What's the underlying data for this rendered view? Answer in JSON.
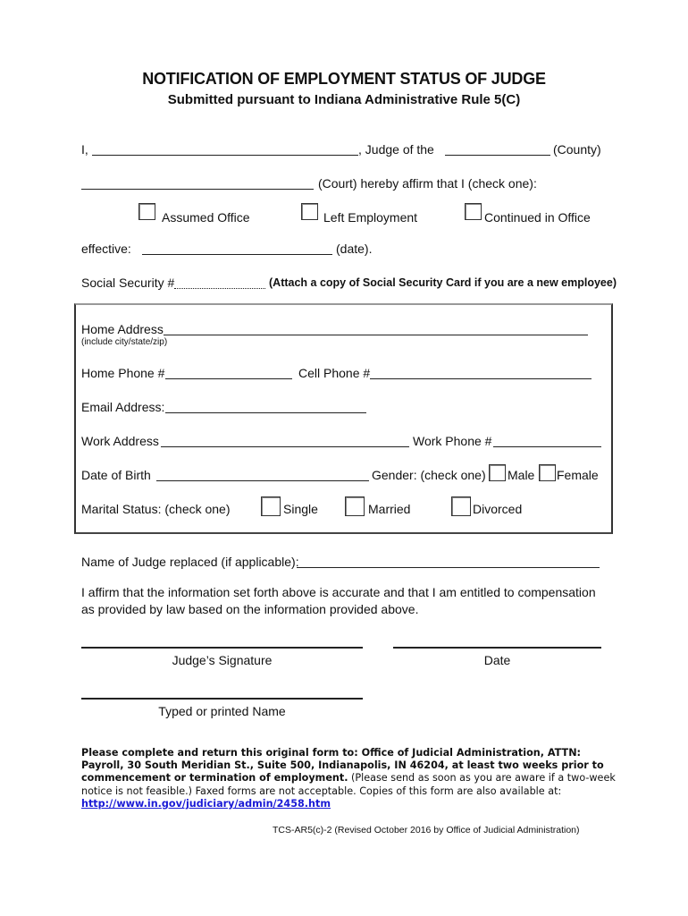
{
  "header": {
    "title": "NOTIFICATION OF EMPLOYMENT STATUS OF JUDGE",
    "subtitle": "Submitted pursuant to Indiana Administrative Rule 5(C)"
  },
  "intro": {
    "prefix": "I,",
    "judge_of_the": ", Judge of the",
    "county_label": "(County)",
    "court_label": "(Court) hereby affirm that I (check one):",
    "name_value": "",
    "county_value": "",
    "court_value": ""
  },
  "status_options": [
    {
      "label": "Assumed Office",
      "checked": false
    },
    {
      "label": "Left Employment",
      "checked": false
    },
    {
      "label": "Continued in Office",
      "checked": false
    }
  ],
  "effective": {
    "label": "effective:",
    "suffix": "(date).",
    "value": ""
  },
  "ssn": {
    "label": "Social Security #",
    "value": "",
    "note": "(Attach a copy of Social Security Card if you are a new employee)"
  },
  "personal": {
    "home_address_label": "Home Address",
    "home_address_hint": "(include city/state/zip)",
    "home_phone_label": "Home Phone #",
    "cell_phone_label": "Cell Phone #",
    "email_label": "Email Address:",
    "work_address_label": "Work Address",
    "work_phone_label": "Work Phone #",
    "dob_label": "Date of Birth",
    "gender_label": "Gender: (check one)",
    "gender_options": [
      {
        "label": "Male",
        "checked": false
      },
      {
        "label": "Female",
        "checked": false
      }
    ],
    "marital_label": "Marital Status: (check one)",
    "marital_options": [
      {
        "label": "Single",
        "checked": false
      },
      {
        "label": "Married",
        "checked": false
      },
      {
        "label": "Divorced",
        "checked": false
      }
    ]
  },
  "replaced": {
    "label": "Name of Judge replaced (if applicable):",
    "value": ""
  },
  "affirmation": {
    "line1": "I affirm that the information set forth above is accurate and that I am entitled to compensation",
    "line2": "as provided by law based on the information provided above."
  },
  "signatures": {
    "signature_label": "Judge’s Signature",
    "date_label": "Date",
    "printed_name_label": "Typed or printed Name"
  },
  "instructions": {
    "bold_text": "Please complete and return this original form to:  Office of Judicial Administration, ATTN: Payroll, 30 South Meridian St., Suite 500, Indianapolis, IN 46204, at least two weeks prior to commencement or termination of employment.",
    "normal_text": " (Please send as soon as you are aware if a two-week notice is not feasible.)  Faxed forms are not acceptable.  Copies of this form are also available at: ",
    "link_text": "http://www.in.gov/judiciary/admin/2458.htm",
    "link_color": "#1a1ad6"
  },
  "footer": {
    "revision": "TCS-AR5(c)-2 (Revised October 2016 by Office of Judicial Administration)"
  }
}
